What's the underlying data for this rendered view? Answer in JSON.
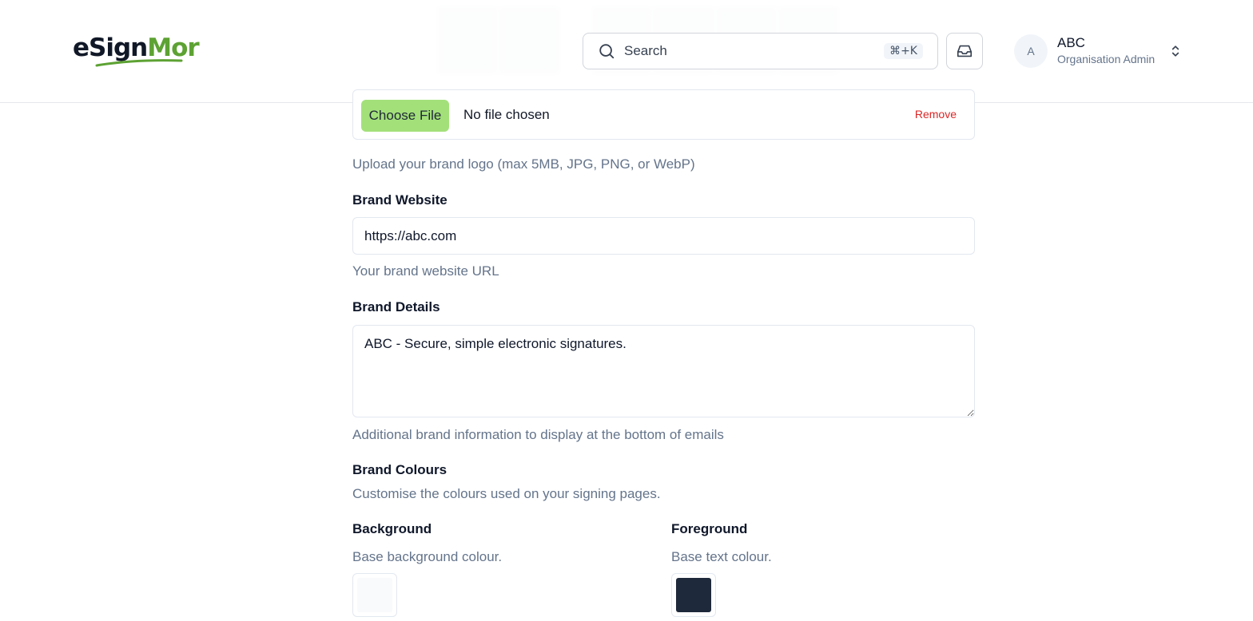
{
  "header": {
    "search": {
      "label": "Search",
      "shortcut": "⌘+K"
    },
    "user": {
      "initial": "A",
      "name": "ABC",
      "role": "Organisation Admin"
    }
  },
  "logo_upload": {
    "button_label": "Choose File",
    "status": "No file chosen",
    "remove_label": "Remove",
    "help": "Upload your brand logo (max 5MB, JPG, PNG, or WebP)"
  },
  "brand_website": {
    "label": "Brand Website",
    "value": "https://abc.com",
    "help": "Your brand website URL"
  },
  "brand_details": {
    "label": "Brand Details",
    "value": "ABC - Secure, simple electronic signatures.",
    "help": "Additional brand information to display at the bottom of emails"
  },
  "brand_colours": {
    "label": "Brand Colours",
    "help": "Customise the colours used on your signing pages.",
    "background": {
      "label": "Background",
      "help": "Base background colour.",
      "color": "#f8fafc"
    },
    "foreground": {
      "label": "Foreground",
      "help": "Base text colour.",
      "color": "#1e293b"
    }
  },
  "icons": {
    "search": "search-icon",
    "inbox": "inbox-icon",
    "chevron": "chevron-up-down-icon"
  },
  "colors": {
    "accent_green": "#a3e07a",
    "danger": "#dc2626",
    "muted": "#64748b"
  }
}
